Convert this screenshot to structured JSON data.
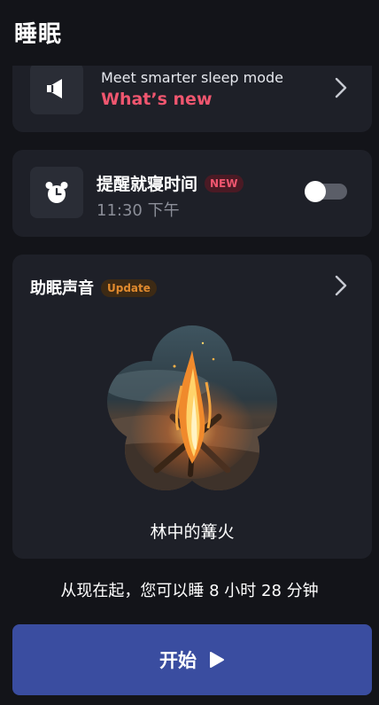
{
  "header": {
    "title": "睡眠"
  },
  "promo": {
    "line1": "Meet smarter sleep mode",
    "line2": "What’s new",
    "icon": "megaphone-icon",
    "accent_color": "#f0566f"
  },
  "reminder": {
    "title": "提醒就寝时间",
    "badge": "NEW",
    "time": "11:30 下午",
    "icon": "alarm-clock-icon",
    "toggle_on": false
  },
  "sound": {
    "title": "助眠声音",
    "badge": "Update",
    "name": "林中的篝火",
    "badge_color": "#e08a2e"
  },
  "sleep_info": "从现在起，您可以睡 8 小时 28 分钟",
  "start_button": {
    "label": "开始",
    "color": "#3a4da0"
  }
}
